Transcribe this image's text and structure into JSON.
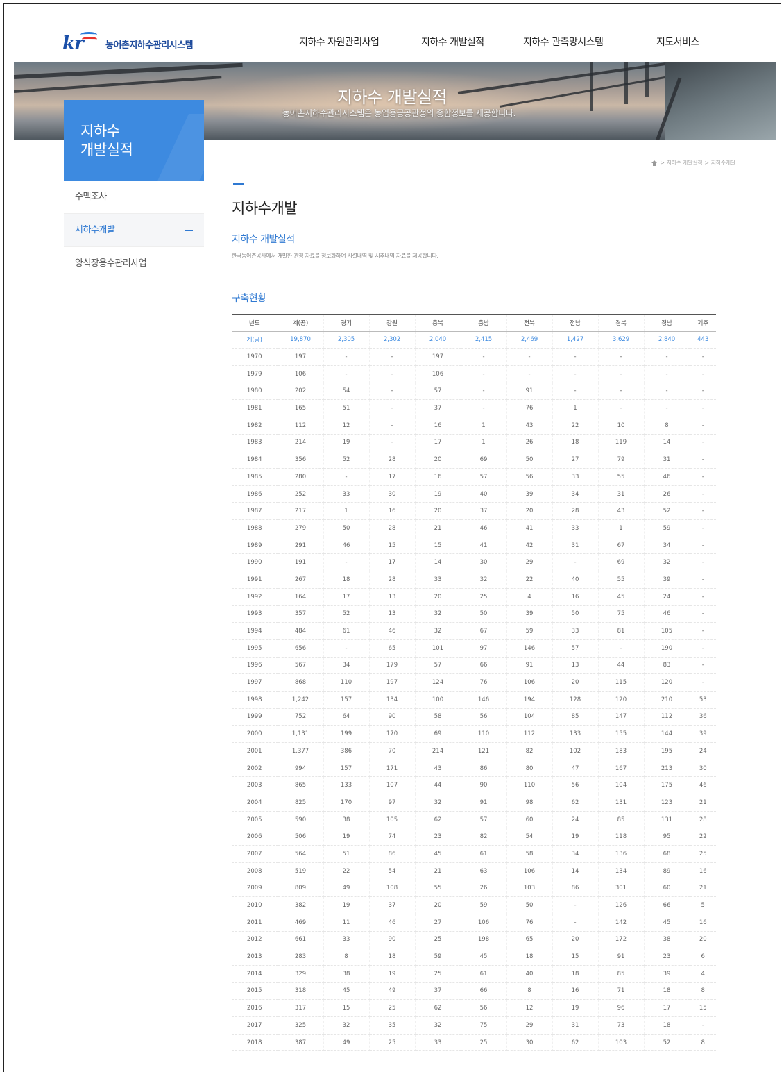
{
  "header": {
    "logo_text": "농어촌지하수관리시스템",
    "nav": [
      "지하수 자원관리사업",
      "지하수 개발실적",
      "지하수 관측망시스템",
      "지도서비스"
    ]
  },
  "banner": {
    "title": "지하수 개발실적",
    "subtitle": "농어촌지하수관리시스템은 농업용공공관정의 종합정보를 제공합니다."
  },
  "sidebar": {
    "title_line1": "지하수",
    "title_line2": "개발실적",
    "items": [
      {
        "label": "수맥조사",
        "active": false
      },
      {
        "label": "지하수개발",
        "active": true
      },
      {
        "label": "양식장용수관리사업",
        "active": false
      }
    ]
  },
  "breadcrumb": [
    "지하수 개발실적",
    "지하수개발"
  ],
  "content": {
    "page_title": "지하수개발",
    "section_title": "지하수 개발실적",
    "section_desc": "한국농어촌공사에서 개발한 관정 자료를 정보화하여 시설내역 및 시추내역 자료를 제공합니다.",
    "sub_title": "구축현황"
  },
  "table": {
    "columns": [
      "년도",
      "계(공)",
      "경기",
      "강원",
      "충북",
      "충남",
      "전북",
      "전남",
      "경북",
      "경남",
      "제주"
    ],
    "total_row": [
      "계(공)",
      "19,870",
      "2,305",
      "2,302",
      "2,040",
      "2,415",
      "2,469",
      "1,427",
      "3,629",
      "2,840",
      "443"
    ],
    "rows": [
      [
        "1970",
        "197",
        "-",
        "-",
        "197",
        "-",
        "-",
        "-",
        "-",
        "-",
        "-"
      ],
      [
        "1979",
        "106",
        "-",
        "-",
        "106",
        "-",
        "-",
        "-",
        "-",
        "-",
        "-"
      ],
      [
        "1980",
        "202",
        "54",
        "-",
        "57",
        "-",
        "91",
        "-",
        "-",
        "-",
        "-"
      ],
      [
        "1981",
        "165",
        "51",
        "-",
        "37",
        "-",
        "76",
        "1",
        "-",
        "-",
        "-"
      ],
      [
        "1982",
        "112",
        "12",
        "-",
        "16",
        "1",
        "43",
        "22",
        "10",
        "8",
        "-"
      ],
      [
        "1983",
        "214",
        "19",
        "-",
        "17",
        "1",
        "26",
        "18",
        "119",
        "14",
        "-"
      ],
      [
        "1984",
        "356",
        "52",
        "28",
        "20",
        "69",
        "50",
        "27",
        "79",
        "31",
        "-"
      ],
      [
        "1985",
        "280",
        "-",
        "17",
        "16",
        "57",
        "56",
        "33",
        "55",
        "46",
        "-"
      ],
      [
        "1986",
        "252",
        "33",
        "30",
        "19",
        "40",
        "39",
        "34",
        "31",
        "26",
        "-"
      ],
      [
        "1987",
        "217",
        "1",
        "16",
        "20",
        "37",
        "20",
        "28",
        "43",
        "52",
        "-"
      ],
      [
        "1988",
        "279",
        "50",
        "28",
        "21",
        "46",
        "41",
        "33",
        "1",
        "59",
        "-"
      ],
      [
        "1989",
        "291",
        "46",
        "15",
        "15",
        "41",
        "42",
        "31",
        "67",
        "34",
        "-"
      ],
      [
        "1990",
        "191",
        "-",
        "17",
        "14",
        "30",
        "29",
        "-",
        "69",
        "32",
        "-"
      ],
      [
        "1991",
        "267",
        "18",
        "28",
        "33",
        "32",
        "22",
        "40",
        "55",
        "39",
        "-"
      ],
      [
        "1992",
        "164",
        "17",
        "13",
        "20",
        "25",
        "4",
        "16",
        "45",
        "24",
        "-"
      ],
      [
        "1993",
        "357",
        "52",
        "13",
        "32",
        "50",
        "39",
        "50",
        "75",
        "46",
        "-"
      ],
      [
        "1994",
        "484",
        "61",
        "46",
        "32",
        "67",
        "59",
        "33",
        "81",
        "105",
        "-"
      ],
      [
        "1995",
        "656",
        "-",
        "65",
        "101",
        "97",
        "146",
        "57",
        "-",
        "190",
        "-"
      ],
      [
        "1996",
        "567",
        "34",
        "179",
        "57",
        "66",
        "91",
        "13",
        "44",
        "83",
        "-"
      ],
      [
        "1997",
        "868",
        "110",
        "197",
        "124",
        "76",
        "106",
        "20",
        "115",
        "120",
        "-"
      ],
      [
        "1998",
        "1,242",
        "157",
        "134",
        "100",
        "146",
        "194",
        "128",
        "120",
        "210",
        "53"
      ],
      [
        "1999",
        "752",
        "64",
        "90",
        "58",
        "56",
        "104",
        "85",
        "147",
        "112",
        "36"
      ],
      [
        "2000",
        "1,131",
        "199",
        "170",
        "69",
        "110",
        "112",
        "133",
        "155",
        "144",
        "39"
      ],
      [
        "2001",
        "1,377",
        "386",
        "70",
        "214",
        "121",
        "82",
        "102",
        "183",
        "195",
        "24"
      ],
      [
        "2002",
        "994",
        "157",
        "171",
        "43",
        "86",
        "80",
        "47",
        "167",
        "213",
        "30"
      ],
      [
        "2003",
        "865",
        "133",
        "107",
        "44",
        "90",
        "110",
        "56",
        "104",
        "175",
        "46"
      ],
      [
        "2004",
        "825",
        "170",
        "97",
        "32",
        "91",
        "98",
        "62",
        "131",
        "123",
        "21"
      ],
      [
        "2005",
        "590",
        "38",
        "105",
        "62",
        "57",
        "60",
        "24",
        "85",
        "131",
        "28"
      ],
      [
        "2006",
        "506",
        "19",
        "74",
        "23",
        "82",
        "54",
        "19",
        "118",
        "95",
        "22"
      ],
      [
        "2007",
        "564",
        "51",
        "86",
        "45",
        "61",
        "58",
        "34",
        "136",
        "68",
        "25"
      ],
      [
        "2008",
        "519",
        "22",
        "54",
        "21",
        "63",
        "106",
        "14",
        "134",
        "89",
        "16"
      ],
      [
        "2009",
        "809",
        "49",
        "108",
        "55",
        "26",
        "103",
        "86",
        "301",
        "60",
        "21"
      ],
      [
        "2010",
        "382",
        "19",
        "37",
        "20",
        "59",
        "50",
        "-",
        "126",
        "66",
        "5"
      ],
      [
        "2011",
        "469",
        "11",
        "46",
        "27",
        "106",
        "76",
        "-",
        "142",
        "45",
        "16"
      ],
      [
        "2012",
        "661",
        "33",
        "90",
        "25",
        "198",
        "65",
        "20",
        "172",
        "38",
        "20"
      ],
      [
        "2013",
        "283",
        "8",
        "18",
        "59",
        "45",
        "18",
        "15",
        "91",
        "23",
        "6"
      ],
      [
        "2014",
        "329",
        "38",
        "19",
        "25",
        "61",
        "40",
        "18",
        "85",
        "39",
        "4"
      ],
      [
        "2015",
        "318",
        "45",
        "49",
        "37",
        "66",
        "8",
        "16",
        "71",
        "18",
        "8"
      ],
      [
        "2016",
        "317",
        "15",
        "25",
        "62",
        "56",
        "12",
        "19",
        "96",
        "17",
        "15"
      ],
      [
        "2017",
        "325",
        "32",
        "35",
        "32",
        "75",
        "29",
        "31",
        "73",
        "18",
        "-"
      ],
      [
        "2018",
        "387",
        "49",
        "25",
        "33",
        "25",
        "30",
        "62",
        "103",
        "52",
        "8"
      ]
    ]
  }
}
